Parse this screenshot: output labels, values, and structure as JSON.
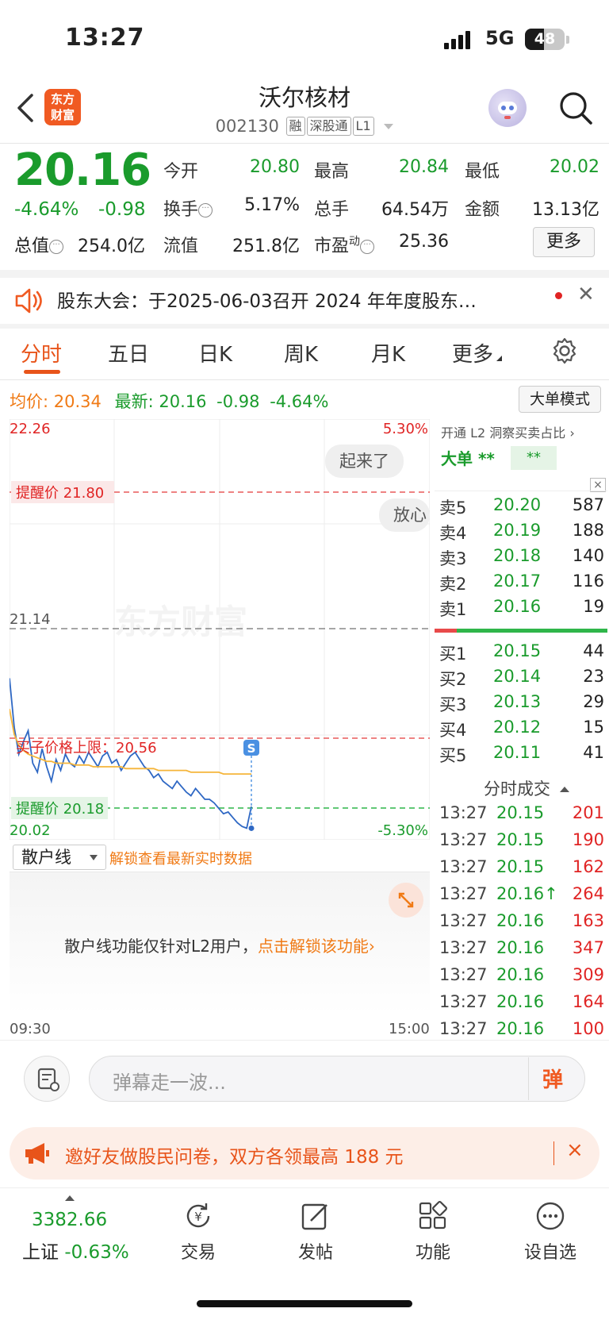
{
  "status": {
    "time": "13:27",
    "network": "5G",
    "battery": "48"
  },
  "header": {
    "title": "沃尔核材",
    "code": "002130",
    "tags": [
      "融",
      "深股通",
      "L1"
    ],
    "logo": "东方财富"
  },
  "quote": {
    "price": "20.16",
    "pct": "-4.64%",
    "change": "-0.98",
    "total_label": "总值",
    "total_value": "254.0亿",
    "fields": [
      {
        "label": "今开",
        "value": "20.80",
        "color": "green"
      },
      {
        "label": "最高",
        "value": "20.84",
        "color": "green"
      },
      {
        "label": "最低",
        "value": "20.02",
        "color": "green"
      },
      {
        "label": "换手",
        "value": "5.17%",
        "color": "black"
      },
      {
        "label": "总手",
        "value": "64.54万",
        "color": "black"
      },
      {
        "label": "金额",
        "value": "13.13亿",
        "color": "black"
      },
      {
        "label": "流值",
        "value": "251.8亿",
        "color": "black"
      },
      {
        "label": "市盈",
        "sup": "动",
        "value": "25.36",
        "color": "black"
      }
    ],
    "more": "更多"
  },
  "notice": {
    "text": "股东大会：于2025-06-03召开 2024 年年度股东…"
  },
  "tabs": [
    "分时",
    "五日",
    "日K",
    "周K",
    "月K",
    "更多"
  ],
  "info": {
    "avg_label": "均价:",
    "avg": "20.34",
    "latest_label": "最新:",
    "latest": "20.16",
    "chg": "-0.98",
    "pct": "-4.64%",
    "mode_btn": "大单模式"
  },
  "chart_labels": {
    "y_top": "22.26",
    "y_bottom": "20.02",
    "pct_top": "5.30%",
    "pct_bottom": "-5.30%",
    "ref": "21.14",
    "alert_high": "提醒价 21.80",
    "alert_low": "提醒价 20.18",
    "limit": "买子价格上限：20.56",
    "chip1": "起来了",
    "chip2": "放心",
    "watermark": "东方财富",
    "marker": "S"
  },
  "chart_data": {
    "type": "line",
    "x_label_start": "09:30",
    "x_label_end": "15:00",
    "ylim": [
      20.02,
      22.26
    ],
    "series": [
      {
        "values": [
          20.87,
          20.6,
          20.45,
          20.52,
          20.58,
          20.4,
          20.35,
          20.48,
          20.38,
          20.3,
          20.42,
          20.36,
          20.45,
          20.4,
          20.38,
          20.44,
          20.4,
          20.46,
          20.42,
          20.38,
          20.44,
          20.46,
          20.4,
          20.42,
          20.36,
          20.4,
          20.44,
          20.46,
          20.42,
          20.38,
          20.36,
          20.32,
          20.34,
          20.3,
          20.28,
          20.26,
          20.3,
          20.27,
          20.24,
          20.22,
          20.26,
          20.23,
          20.2,
          20.2,
          20.18,
          20.15,
          20.12,
          20.13,
          20.1,
          20.07,
          20.05,
          20.04,
          20.16
        ]
      },
      {
        "values": [
          20.7,
          20.56,
          20.5,
          20.47,
          20.45,
          20.44,
          20.43,
          20.42,
          20.41,
          20.41,
          20.4,
          20.4,
          20.4,
          20.4,
          20.39,
          20.39,
          20.39,
          20.39,
          20.38,
          20.38,
          20.38,
          20.38,
          20.38,
          20.38,
          20.38,
          20.37,
          20.37,
          20.37,
          20.37,
          20.37,
          20.37,
          20.37,
          20.36,
          20.36,
          20.36,
          20.36,
          20.36,
          20.36,
          20.36,
          20.35,
          20.35,
          20.35,
          20.35,
          20.35,
          20.35,
          20.35,
          20.34,
          20.34,
          20.34,
          20.34,
          20.34,
          20.34,
          20.34
        ]
      }
    ]
  },
  "right_panel": {
    "top_text": "开通 L2 洞察买卖占比 ›",
    "big_label": "大单",
    "big_val1": "**",
    "big_val2": "**",
    "close": "×",
    "asks": [
      {
        "label": "卖5",
        "price": "20.20",
        "vol": "587"
      },
      {
        "label": "卖4",
        "price": "20.19",
        "vol": "188"
      },
      {
        "label": "卖3",
        "price": "20.18",
        "vol": "140"
      },
      {
        "label": "卖2",
        "price": "20.17",
        "vol": "116"
      },
      {
        "label": "卖1",
        "price": "20.16",
        "vol": "19"
      }
    ],
    "bids": [
      {
        "label": "买1",
        "price": "20.15",
        "vol": "44"
      },
      {
        "label": "买2",
        "price": "20.14",
        "vol": "23"
      },
      {
        "label": "买3",
        "price": "20.13",
        "vol": "29"
      },
      {
        "label": "买4",
        "price": "20.12",
        "vol": "15"
      },
      {
        "label": "买5",
        "price": "20.11",
        "vol": "41"
      }
    ],
    "ticks_title": "分时成交",
    "ticks": [
      {
        "t": "13:27",
        "p": "20.15",
        "v": "201"
      },
      {
        "t": "13:27",
        "p": "20.15",
        "v": "190"
      },
      {
        "t": "13:27",
        "p": "20.15",
        "v": "162"
      },
      {
        "t": "13:27",
        "p": "20.16↑",
        "v": "264"
      },
      {
        "t": "13:27",
        "p": "20.16",
        "v": "163"
      },
      {
        "t": "13:27",
        "p": "20.16",
        "v": "347"
      },
      {
        "t": "13:27",
        "p": "20.16",
        "v": "309"
      },
      {
        "t": "13:27",
        "p": "20.16",
        "v": "164"
      },
      {
        "t": "13:27",
        "p": "20.16",
        "v": "100"
      }
    ]
  },
  "sub_chart": {
    "selector": "散户线",
    "hint": "解锁查看最新实时数据",
    "msg": "散户线功能仅针对L2用户，",
    "msg_link": "点击解锁该功能›"
  },
  "comment": {
    "placeholder": "弹幕走一波...",
    "send": "弹"
  },
  "invite": {
    "text": "邀好友做股民问卷，双方各领最高 188 元",
    "close": "×"
  },
  "bottom_nav": {
    "index_value": "3382.66",
    "index_name": "上证",
    "index_pct": "-0.63%",
    "items": [
      {
        "label": "交易",
        "icon": "trade-icon"
      },
      {
        "label": "发帖",
        "icon": "edit-icon"
      },
      {
        "label": "功能",
        "icon": "grid-icon"
      },
      {
        "label": "设自选",
        "icon": "more-icon"
      }
    ]
  }
}
